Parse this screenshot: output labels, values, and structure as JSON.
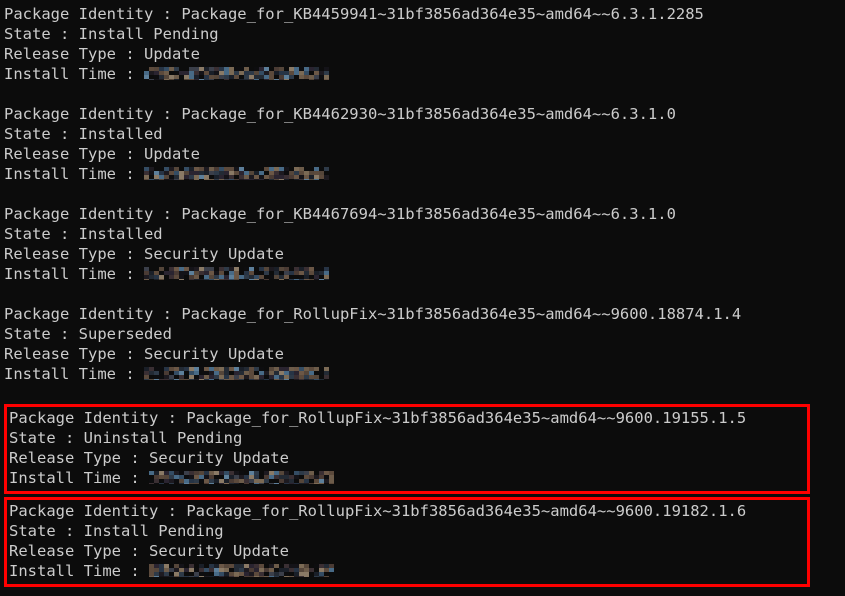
{
  "terminal": {
    "background_color": "#0c0c0c",
    "text_color": "#cccccc",
    "highlight_color": "#ff0000",
    "labels": {
      "package_identity": "Package Identity :",
      "state": "State :",
      "release_type": "Release Type :",
      "install_time": "Install Time :"
    },
    "redacted_placeholder": "",
    "packages": [
      {
        "package_identity": "Package_for_KB4459941~31bf3856ad364e35~amd64~~6.3.1.2285",
        "state": "Install Pending",
        "release_type": "Update",
        "install_time": "",
        "install_time_redacted": true,
        "highlighted": false
      },
      {
        "package_identity": "Package_for_KB4462930~31bf3856ad364e35~amd64~~6.3.1.0",
        "state": "Installed",
        "release_type": "Update",
        "install_time": "",
        "install_time_redacted": true,
        "highlighted": false
      },
      {
        "package_identity": "Package_for_KB4467694~31bf3856ad364e35~amd64~~6.3.1.0",
        "state": "Installed",
        "release_type": "Security Update",
        "install_time": "",
        "install_time_redacted": true,
        "highlighted": false
      },
      {
        "package_identity": "Package_for_RollupFix~31bf3856ad364e35~amd64~~9600.18874.1.4",
        "state": "Superseded",
        "release_type": "Security Update",
        "install_time": "",
        "install_time_redacted": true,
        "highlighted": false
      },
      {
        "package_identity": "Package_for_RollupFix~31bf3856ad364e35~amd64~~9600.19155.1.5",
        "state": "Uninstall Pending",
        "release_type": "Security Update",
        "install_time": "",
        "install_time_redacted": true,
        "highlighted": true
      },
      {
        "package_identity": "Package_for_RollupFix~31bf3856ad364e35~amd64~~9600.19182.1.6",
        "state": "Install Pending",
        "release_type": "Security Update",
        "install_time": "",
        "install_time_redacted": true,
        "highlighted": true
      }
    ]
  }
}
